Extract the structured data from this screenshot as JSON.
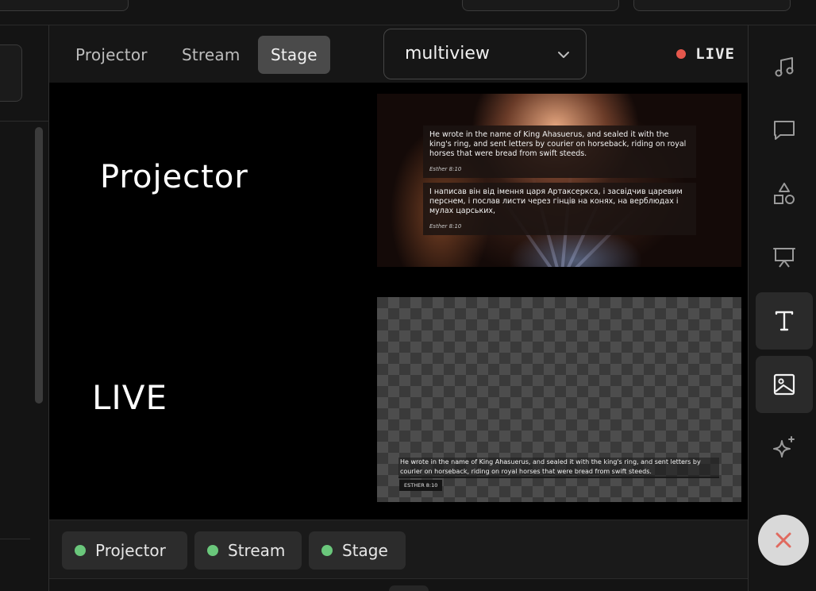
{
  "tabs": [
    {
      "label": "Projector",
      "active": false
    },
    {
      "label": "Stream",
      "active": false
    },
    {
      "label": "Stage",
      "active": true
    }
  ],
  "layout_select": {
    "value": "multiview"
  },
  "live_indicator": {
    "label": "LIVE",
    "color": "#e5574c"
  },
  "preview": {
    "projector_label": "Projector",
    "live_label": "LIVE",
    "projector_screen": {
      "verse_en": "He wrote in the name of King Ahasuerus, and sealed it with the king's ring, and sent letters by courier on horseback, riding on royal horses that were bread from swift steeds.",
      "ref_en": "Esther 8:10",
      "verse_uk": "І написав він від імення царя Артаксеркса, і засвідчив царевим перснем, і послав листи через гінців на конях, на верблюдах і мулах царських,",
      "ref_uk": "Esther 8:10"
    },
    "live_screen": {
      "verse": "He wrote in the name of King Ahasuerus, and sealed it with the king's ring, and sent letters by courier on horseback, riding on royal horses that were bread from swift steeds.",
      "ref": "ESTHER 8:10"
    }
  },
  "outputs": [
    {
      "label": "Projector",
      "status_color": "#6ac77b"
    },
    {
      "label": "Stream",
      "status_color": "#6ac77b"
    },
    {
      "label": "Stage",
      "status_color": "#6ac77b"
    }
  ],
  "sidebar_icons": [
    {
      "name": "music-icon"
    },
    {
      "name": "chat-bubble-icon"
    },
    {
      "name": "shapes-icon"
    },
    {
      "name": "presentation-icon"
    },
    {
      "name": "text-icon",
      "selected": true
    },
    {
      "name": "image-icon",
      "selected": true
    },
    {
      "name": "sparkles-icon"
    }
  ],
  "close_button": {
    "icon": "close-icon",
    "color": "#e06a5f"
  }
}
